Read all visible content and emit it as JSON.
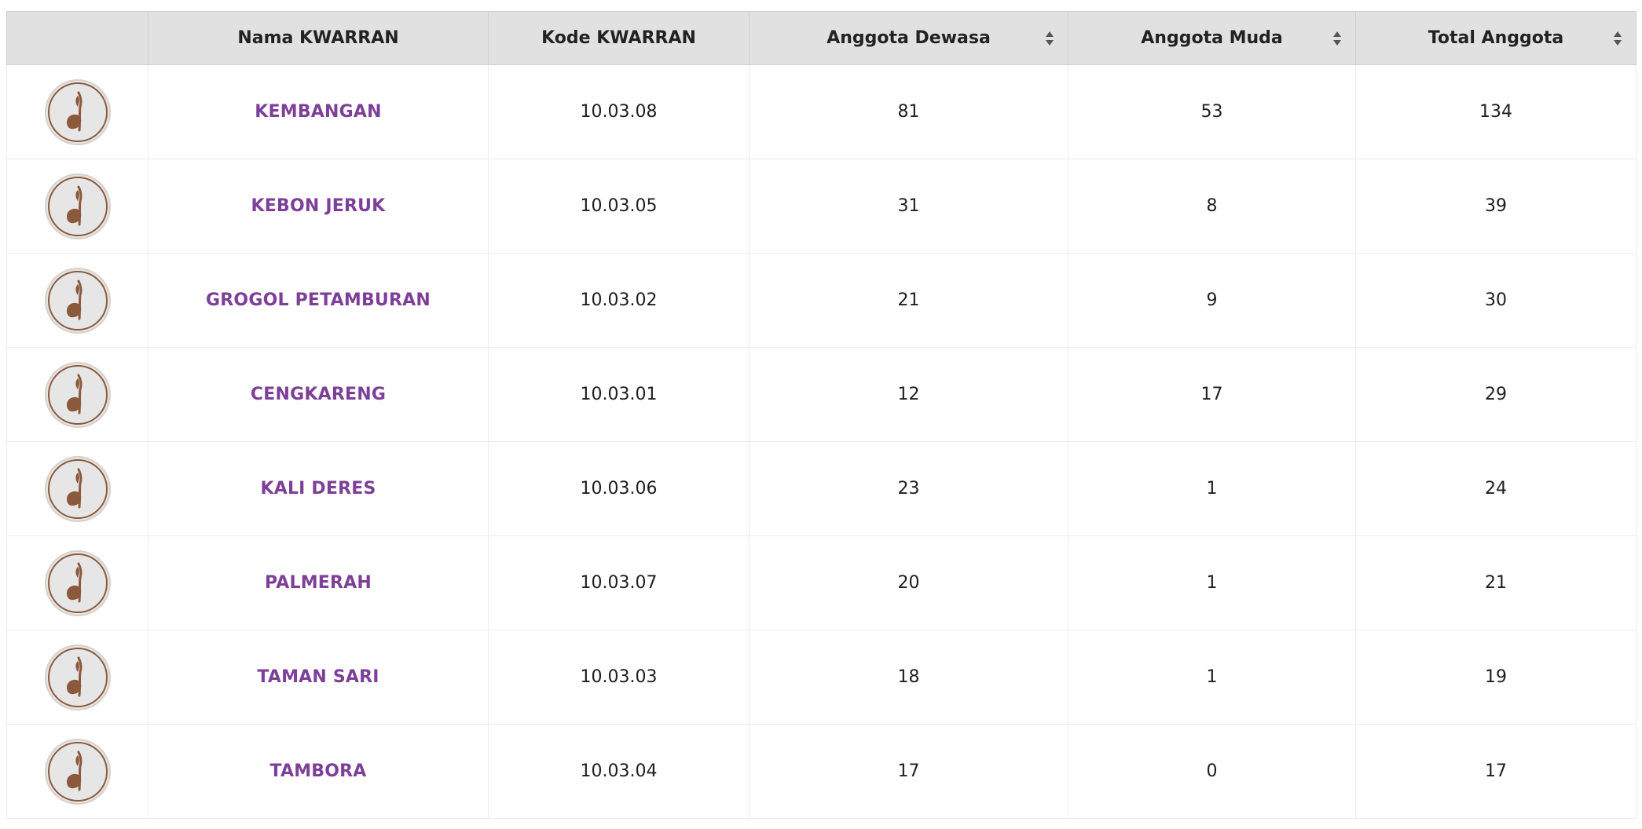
{
  "table": {
    "headers": {
      "logo": "",
      "name": "Nama KWARRAN",
      "code": "Kode KWARRAN",
      "dewasa": "Anggota Dewasa",
      "muda": "Anggota Muda",
      "total": "Total Anggota"
    },
    "sortable_columns": [
      "Anggota Dewasa",
      "Anggota Muda",
      "Total Anggota"
    ],
    "logo_icon": "scout-tunas-kelapa-icon",
    "colors": {
      "header_bg": "#e1e1e1",
      "name_link": "#7d3f98",
      "logo_brown": "#8b5a3c",
      "logo_bg": "#e6e6e6"
    },
    "rows": [
      {
        "name": "KEMBANGAN",
        "code": "10.03.08",
        "dewasa": "81",
        "muda": "53",
        "total": "134"
      },
      {
        "name": "KEBON JERUK",
        "code": "10.03.05",
        "dewasa": "31",
        "muda": "8",
        "total": "39"
      },
      {
        "name": "GROGOL PETAMBURAN",
        "code": "10.03.02",
        "dewasa": "21",
        "muda": "9",
        "total": "30"
      },
      {
        "name": "CENGKARENG",
        "code": "10.03.01",
        "dewasa": "12",
        "muda": "17",
        "total": "29"
      },
      {
        "name": "KALI DERES",
        "code": "10.03.06",
        "dewasa": "23",
        "muda": "1",
        "total": "24"
      },
      {
        "name": "PALMERAH",
        "code": "10.03.07",
        "dewasa": "20",
        "muda": "1",
        "total": "21"
      },
      {
        "name": "TAMAN SARI",
        "code": "10.03.03",
        "dewasa": "18",
        "muda": "1",
        "total": "19"
      },
      {
        "name": "TAMBORA",
        "code": "10.03.04",
        "dewasa": "17",
        "muda": "0",
        "total": "17"
      }
    ]
  }
}
